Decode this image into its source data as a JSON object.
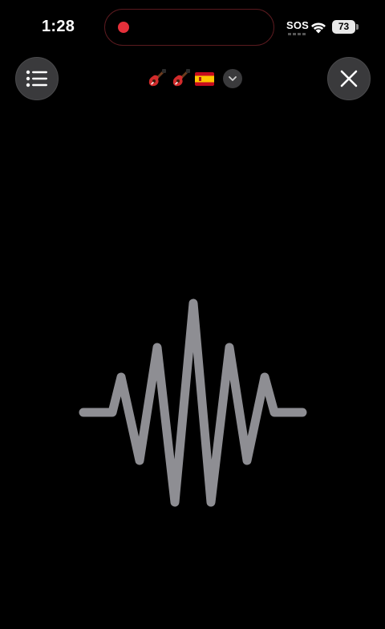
{
  "status_bar": {
    "time": "1:28",
    "sos": "SOS",
    "battery": "73",
    "recording_color": "#e5303a"
  },
  "toolbar": {
    "list_icon": "list-icon",
    "close_icon": "close-icon",
    "language_emojis": [
      "guitar-emoji",
      "guitar-emoji",
      "spain-flag-emoji"
    ],
    "dropdown_icon": "chevron-down-icon"
  },
  "waveform": {
    "color": "#8e8e93",
    "icon": "audio-waveform-icon"
  }
}
